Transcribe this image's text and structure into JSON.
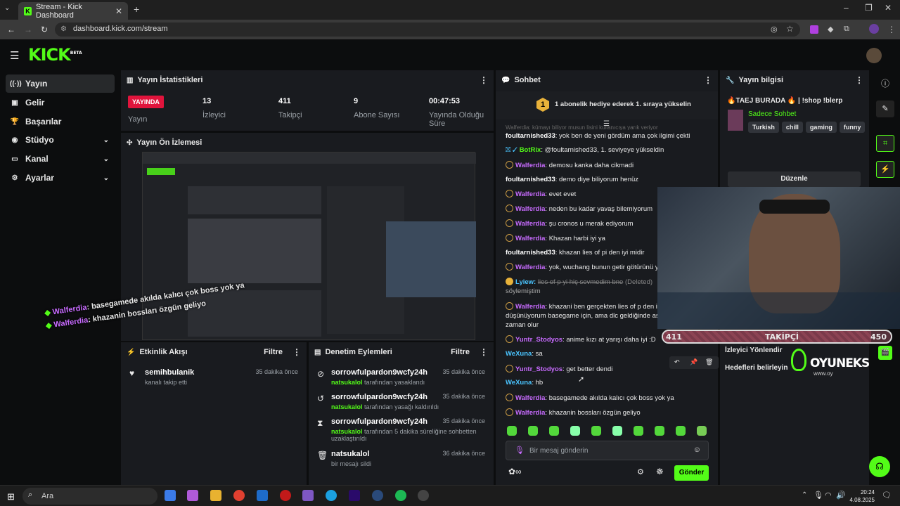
{
  "browser": {
    "tab_title": "Stream - Kick Dashboard",
    "url": "dashboard.kick.com/stream"
  },
  "brand": {
    "logo": "KICK",
    "logo_sup": "BETA",
    "accent": "#53fc18"
  },
  "sidebar": {
    "items": [
      {
        "label": "Yayın",
        "icon": "broadcast-icon"
      },
      {
        "label": "Gelir",
        "icon": "revenue-icon"
      },
      {
        "label": "Başarılar",
        "icon": "trophy-icon"
      },
      {
        "label": "Stüdyo",
        "icon": "studio-icon"
      },
      {
        "label": "Kanal",
        "icon": "channel-icon"
      },
      {
        "label": "Ayarlar",
        "icon": "gear-icon"
      }
    ]
  },
  "stats": {
    "title": "Yayın İstatistikleri",
    "live_badge": "YAYINDA",
    "live_label": "Yayın",
    "viewers": "13",
    "viewers_label": "İzleyici",
    "followers": "411",
    "followers_label": "Takipçi",
    "subs": "9",
    "subs_label": "Abone Sayısı",
    "duration": "00:47:53",
    "duration_label": "Yayında Olduğu Süre"
  },
  "preview": {
    "title": "Yayın Ön İzlemesi",
    "overlay": [
      {
        "user": "Walferdia",
        "text": ": basegamede akılda kalıcı çok boss yok ya"
      },
      {
        "user": "Walferdia",
        "text": ": khazanin bossları özgün geliyo"
      }
    ]
  },
  "activity": {
    "title": "Etkinlik Akışı",
    "filter": "Filtre",
    "items": [
      {
        "user": "semihbulanik",
        "text": "kanalı takip etti",
        "time": "35 dakika önce"
      }
    ]
  },
  "moderation": {
    "title": "Denetim Eylemleri",
    "filter": "Filtre",
    "items": [
      {
        "user": "sorrowfulpardon9wcfy24h",
        "mod": "natsukalol",
        "text": "tarafından yasaklandı",
        "time": "35 dakika önce",
        "icon": "ban-icon"
      },
      {
        "user": "sorrowfulpardon9wcfy24h",
        "mod": "natsukalol",
        "text": "tarafından yasağı kaldırıldı",
        "time": "35 dakika önce",
        "icon": "undo-icon"
      },
      {
        "user": "sorrowfulpardon9wcfy24h",
        "mod": "natsukalol",
        "text": "tarafından 5 dakika süreliğine sohbetten",
        "text2": "uzaklaştırıldı",
        "time": "35 dakika önce",
        "icon": "hourglass-icon"
      },
      {
        "user": "natsukalol",
        "mod": "",
        "text": "bir mesajı sildi",
        "time": "36 dakika önce",
        "icon": "trash-icon"
      }
    ]
  },
  "chat": {
    "title": "Sohbet",
    "pinned": "1 abonelik hediye ederek 1. sıraya yükselin",
    "pinned_rank": "1",
    "cut_line": "Walferdia: kümayı biliyor musun lisini kullanıcıya yarık veriyor",
    "messages": [
      {
        "user": "foultarnished33",
        "sep": ": ",
        "text": "yok ben de yeni gördüm ama çok ilgimi çekti",
        "cls": "cu-w"
      },
      {
        "user": "BotRix",
        "sep": ": ",
        "text": "@foultarnished33, 1. seviyeye yükseldin",
        "cls": "cu-g",
        "bot": true
      },
      {
        "user": "Walferdia",
        "sep": ": ",
        "text": "demosu kanka daha cikmadi",
        "cls": "cu-p",
        "mod": true
      },
      {
        "user": "foultarnished33",
        "sep": ": ",
        "text": "demo diye biliyorum henüz",
        "cls": "cu-w"
      },
      {
        "user": "Walferdia",
        "sep": ": ",
        "text": "evet evet",
        "cls": "cu-p",
        "mod": true
      },
      {
        "user": "Walferdia",
        "sep": ": ",
        "text": "neden bu kadar yavaş bilemiyorum",
        "cls": "cu-p",
        "mod": true
      },
      {
        "user": "Walferdia",
        "sep": ": ",
        "text": "şu cronos u merak ediyorum",
        "cls": "cu-p",
        "mod": true
      },
      {
        "user": "Walferdia",
        "sep": ": ",
        "text": "Khazan harbi iyi ya",
        "cls": "cu-p",
        "mod": true
      },
      {
        "user": "foultarnished33",
        "sep": ": ",
        "text": "khazan lies of pi den iyi midir",
        "cls": "cu-w"
      },
      {
        "user": "Walferdia",
        "sep": ": ",
        "text": "yok, wuchang bunun getir götürünü ya",
        "cls": "cu-p",
        "mod": true
      }
    ],
    "deleted": {
      "user": "Lyiew",
      "text": "lies of p yi hiç sevmedim bne",
      "tag": "(Deleted)",
      "cont": "söylemiştim"
    },
    "long": {
      "user": "Walferdia",
      "text": "khazani ben gerçekten lies of p den iyi",
      "l2": "düşünüyorum basegame için, ama dlc geldiğinde asıl",
      "l3": "zaman olur"
    },
    "tail": [
      {
        "user": "Yuntr_Stodyos",
        "sep": ": ",
        "text": "anime kızı at yarışı daha iyi :D",
        "cls": "cu-p",
        "mod": true
      },
      {
        "user": "WeXuna",
        "sep": ": ",
        "text": "sa",
        "cls": "cu-b"
      },
      {
        "user": "Yuntr_Stodyos",
        "sep": ": ",
        "text": "get better dendi",
        "cls": "cu-p",
        "mod": true
      },
      {
        "user": "WeXuna",
        "sep": ": ",
        "text": "hb",
        "cls": "cu-b"
      },
      {
        "user": "Walferdia",
        "sep": ": ",
        "text": "basegamede akılda kalıcı çok boss yok ya",
        "cls": "cu-p",
        "mod": true
      },
      {
        "user": "Walferdia",
        "sep": ": ",
        "text": "khazanin bossları özgün geliyo",
        "cls": "cu-p",
        "mod": true
      }
    ],
    "input_placeholder": "Bir mesaj gönderin",
    "send": "Gönder"
  },
  "stream_info": {
    "title": "Yayın bilgisi",
    "stream_title": "🔥TAEJ BURADA 🔥 | !shop !blerp",
    "category": "Sadece Sohbet",
    "tags": [
      "Turkish",
      "chill",
      "gaming",
      "funny"
    ],
    "edit": "Düzenle",
    "link1": "İzleyici Yönlendir",
    "link2": "Hedefleri belirleyin"
  },
  "webcam": {
    "followers_goal_label": "TAKİPÇİ",
    "followers_current": "411",
    "followers_goal": "450",
    "sponsor": "OYUNEKS",
    "sponsor_url": "www.oy"
  },
  "taskbar": {
    "search": "Ara",
    "time": "20:24",
    "date": "4.08.2025"
  }
}
